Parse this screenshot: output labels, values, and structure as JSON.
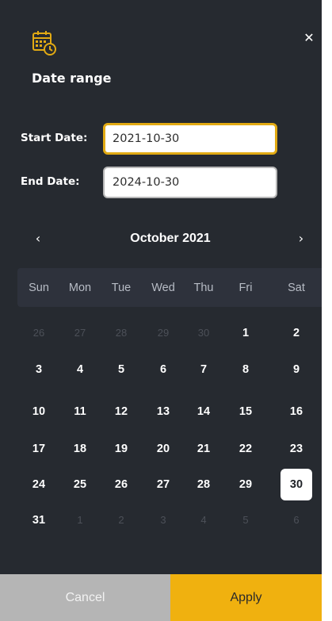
{
  "colors": {
    "panel": "#262a30",
    "accent": "#f0b10f",
    "focus_border": "#e2aa13",
    "cancel_bg": "#b5b5b5",
    "weekday_bar": "#2e323c"
  },
  "header": {
    "icon": "calendar-clock-icon",
    "close_icon": "close-icon",
    "close_symbol": "✕",
    "title": "Date range"
  },
  "form": {
    "start_label": "Start Date:",
    "start_value": "2021-10-30",
    "end_label": "End Date:",
    "end_value": "2024-10-30"
  },
  "calendar": {
    "prev_symbol": "‹",
    "next_symbol": "›",
    "month_label": "October 2021",
    "weekdays": [
      "Sun",
      "Mon",
      "Tue",
      "Wed",
      "Thu",
      "Fri",
      "Sat"
    ],
    "weeks": [
      [
        "26",
        "27",
        "28",
        "29",
        "30",
        "1",
        "2"
      ],
      [
        "3",
        "4",
        "5",
        "6",
        "7",
        "8",
        "9"
      ],
      [
        "10",
        "11",
        "12",
        "13",
        "14",
        "15",
        "16"
      ],
      [
        "17",
        "18",
        "19",
        "20",
        "21",
        "22",
        "23"
      ],
      [
        "24",
        "25",
        "26",
        "27",
        "28",
        "29",
        "30"
      ],
      [
        "31",
        "1",
        "2",
        "3",
        "4",
        "5",
        "6"
      ]
    ],
    "outside": [
      [
        true,
        true,
        true,
        true,
        true,
        false,
        false
      ],
      [
        false,
        false,
        false,
        false,
        false,
        false,
        false
      ],
      [
        false,
        false,
        false,
        false,
        false,
        false,
        false
      ],
      [
        false,
        false,
        false,
        false,
        false,
        false,
        false
      ],
      [
        false,
        false,
        false,
        false,
        false,
        false,
        false
      ],
      [
        false,
        true,
        true,
        true,
        true,
        true,
        true
      ]
    ],
    "selected_day": "30"
  },
  "footer": {
    "cancel_label": "Cancel",
    "apply_label": "Apply"
  }
}
